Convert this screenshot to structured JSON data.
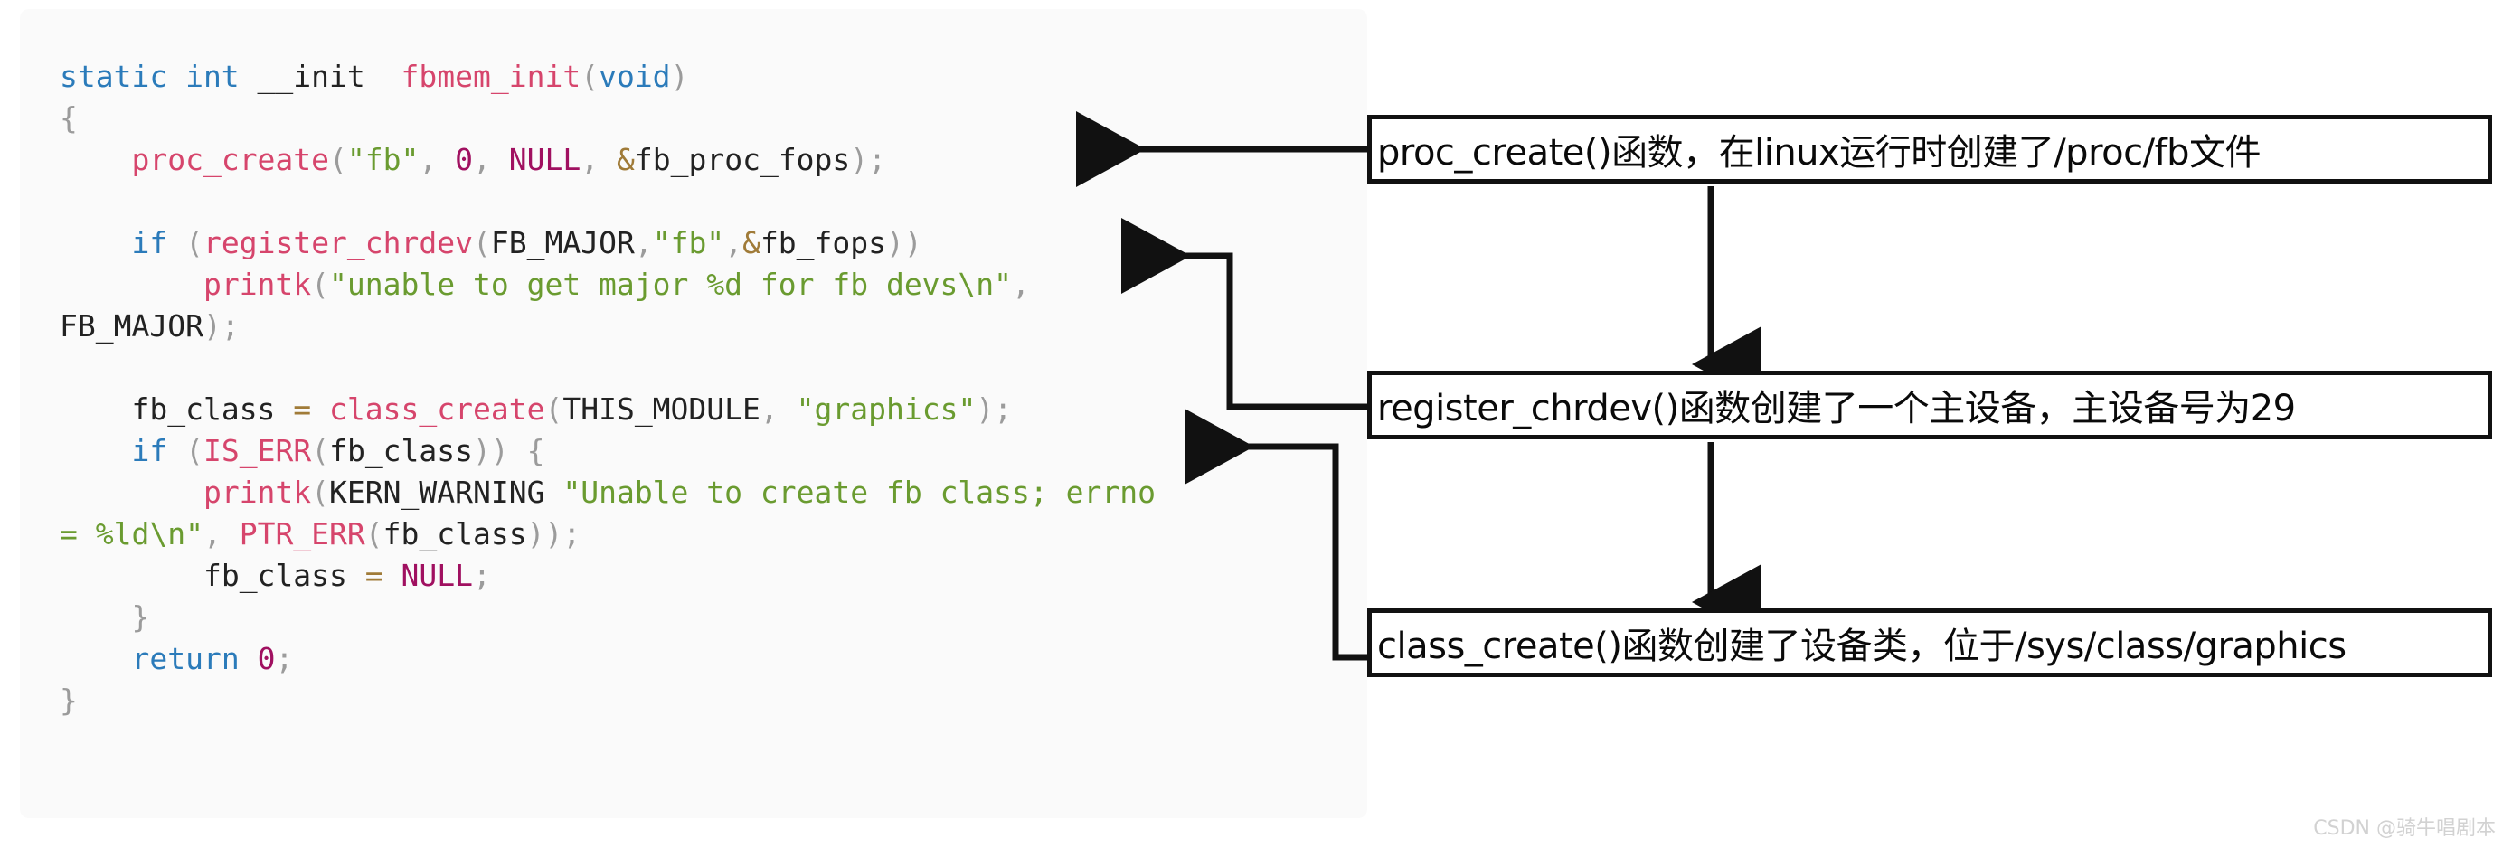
{
  "code": {
    "language": "c",
    "lines": [
      [
        {
          "t": "static int ",
          "c": "kw"
        },
        {
          "t": "__init",
          "c": "pln"
        },
        {
          "t": "  ",
          "c": "pln"
        },
        {
          "t": "fbmem_init",
          "c": "fn"
        },
        {
          "t": "(",
          "c": "pun"
        },
        {
          "t": "void",
          "c": "kw"
        },
        {
          "t": ")",
          "c": "pun"
        }
      ],
      [
        {
          "t": "{",
          "c": "pun"
        }
      ],
      [
        {
          "t": "    ",
          "c": "pln"
        },
        {
          "t": "proc_create",
          "c": "fn"
        },
        {
          "t": "(",
          "c": "pun"
        },
        {
          "t": "\"fb\"",
          "c": "str"
        },
        {
          "t": ", ",
          "c": "pun"
        },
        {
          "t": "0",
          "c": "num"
        },
        {
          "t": ", ",
          "c": "pun"
        },
        {
          "t": "NULL",
          "c": "num"
        },
        {
          "t": ", ",
          "c": "pun"
        },
        {
          "t": "&",
          "c": "amp"
        },
        {
          "t": "fb_proc_fops",
          "c": "pln"
        },
        {
          "t": ");",
          "c": "pun"
        }
      ],
      [],
      [
        {
          "t": "    ",
          "c": "pln"
        },
        {
          "t": "if",
          "c": "kw"
        },
        {
          "t": " (",
          "c": "pun"
        },
        {
          "t": "register_chrdev",
          "c": "fn"
        },
        {
          "t": "(",
          "c": "pun"
        },
        {
          "t": "FB_MAJOR",
          "c": "pln"
        },
        {
          "t": ",",
          "c": "pun"
        },
        {
          "t": "\"fb\"",
          "c": "str"
        },
        {
          "t": ",",
          "c": "pun"
        },
        {
          "t": "&",
          "c": "amp"
        },
        {
          "t": "fb_fops",
          "c": "pln"
        },
        {
          "t": "))",
          "c": "pun"
        }
      ],
      [
        {
          "t": "        ",
          "c": "pln"
        },
        {
          "t": "printk",
          "c": "fn"
        },
        {
          "t": "(",
          "c": "pun"
        },
        {
          "t": "\"unable to get major %d for fb devs\\n\"",
          "c": "str"
        },
        {
          "t": ",",
          "c": "pun"
        },
        {
          "t": "\n",
          "c": "pln"
        },
        {
          "t": "FB_MAJOR",
          "c": "pln"
        },
        {
          "t": ");",
          "c": "pun"
        }
      ],
      [],
      [
        {
          "t": "    ",
          "c": "pln"
        },
        {
          "t": "fb_class",
          "c": "pln"
        },
        {
          "t": " = ",
          "c": "amp"
        },
        {
          "t": "class_create",
          "c": "fn"
        },
        {
          "t": "(",
          "c": "pun"
        },
        {
          "t": "THIS_MODULE",
          "c": "pln"
        },
        {
          "t": ", ",
          "c": "pun"
        },
        {
          "t": "\"graphics\"",
          "c": "str"
        },
        {
          "t": ");",
          "c": "pun"
        }
      ],
      [
        {
          "t": "    ",
          "c": "pln"
        },
        {
          "t": "if",
          "c": "kw"
        },
        {
          "t": " (",
          "c": "pun"
        },
        {
          "t": "IS_ERR",
          "c": "fn"
        },
        {
          "t": "(",
          "c": "pun"
        },
        {
          "t": "fb_class",
          "c": "pln"
        },
        {
          "t": ")) {",
          "c": "pun"
        }
      ],
      [
        {
          "t": "        ",
          "c": "pln"
        },
        {
          "t": "printk",
          "c": "fn"
        },
        {
          "t": "(",
          "c": "pun"
        },
        {
          "t": "KERN_WARNING",
          "c": "pln"
        },
        {
          "t": " ",
          "c": "pln"
        },
        {
          "t": "\"Unable to create fb class; errno\n= %ld\\n\"",
          "c": "str"
        },
        {
          "t": ", ",
          "c": "pun"
        },
        {
          "t": "PTR_ERR",
          "c": "fn"
        },
        {
          "t": "(",
          "c": "pun"
        },
        {
          "t": "fb_class",
          "c": "pln"
        },
        {
          "t": "));",
          "c": "pun"
        }
      ],
      [
        {
          "t": "        ",
          "c": "pln"
        },
        {
          "t": "fb_class",
          "c": "pln"
        },
        {
          "t": " = ",
          "c": "amp"
        },
        {
          "t": "NULL",
          "c": "num"
        },
        {
          "t": ";",
          "c": "pun"
        }
      ],
      [
        {
          "t": "    ",
          "c": "pln"
        },
        {
          "t": "}",
          "c": "pun"
        }
      ],
      [
        {
          "t": "    ",
          "c": "pln"
        },
        {
          "t": "return",
          "c": "kw"
        },
        {
          "t": " ",
          "c": "pln"
        },
        {
          "t": "0",
          "c": "num"
        },
        {
          "t": ";",
          "c": "pun"
        }
      ],
      [
        {
          "t": "}",
          "c": "pun"
        }
      ]
    ]
  },
  "annotations": [
    {
      "id": "note-1",
      "text": "proc_create()函数，在linux运行时创建了/proc/fb文件",
      "target": "proc_create-call"
    },
    {
      "id": "note-2",
      "text": "register_chrdev()函数创建了一个主设备，主设备号为29",
      "target": "register_chrdev-call"
    },
    {
      "id": "note-3",
      "text": "class_create()函数创建了设备类，位于/sys/class/graphics",
      "target": "class_create-call"
    }
  ],
  "colors": {
    "panel_bg": "#fafafa",
    "box_border": "#111111",
    "connector": "#111111",
    "keyword": "#2b7bba",
    "function": "#d6456c",
    "string": "#6a9b30",
    "number": "#a01060",
    "punctuation": "#9b9b9b",
    "operator": "#a07b38",
    "watermark": "#d2d2d2"
  },
  "watermark": {
    "text": "CSDN @骑牛唱剧本"
  }
}
